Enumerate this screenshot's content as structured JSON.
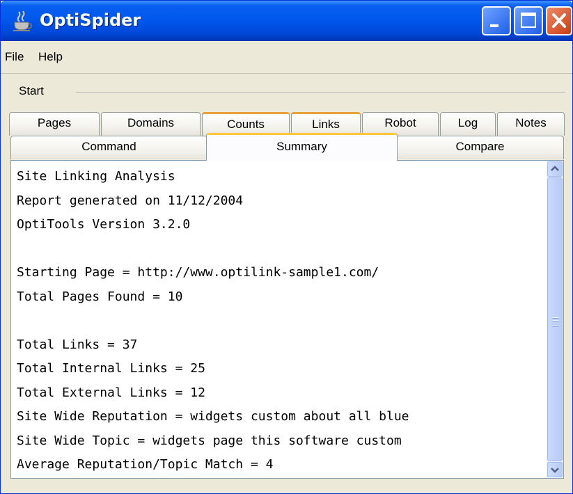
{
  "window": {
    "title": "OptiSpider"
  },
  "menu": {
    "items": [
      "File",
      "Help"
    ]
  },
  "toolbar": {
    "start_label": "Start"
  },
  "tabs_row1": [
    "Pages",
    "Domains",
    "Counts",
    "Links",
    "Robot",
    "Log",
    "Notes"
  ],
  "tabs_row2": [
    "Command",
    "Summary",
    "Compare"
  ],
  "active_tab": "Summary",
  "report": {
    "lines": [
      "Site Linking Analysis",
      "Report generated on 11/12/2004",
      "OptiTools Version 3.2.0",
      "",
      "Starting Page = http://www.optilink-sample1.com/",
      "Total Pages Found = 10",
      "",
      "Total Links = 37",
      "Total Internal Links = 25",
      "Total External Links = 12",
      "Site Wide Reputation = widgets custom about all blue",
      "Site Wide Topic = widgets page this software custom",
      "Average Reputation/Topic Match = 4"
    ]
  },
  "colors": {
    "titlebar": "#0058ee",
    "active_tab_accent": "#ffc83c",
    "close_button": "#c93d12"
  },
  "icons": {
    "app": "coffee-cup-icon",
    "minimize": "minimize-icon",
    "maximize": "maximize-icon",
    "close": "close-icon"
  }
}
